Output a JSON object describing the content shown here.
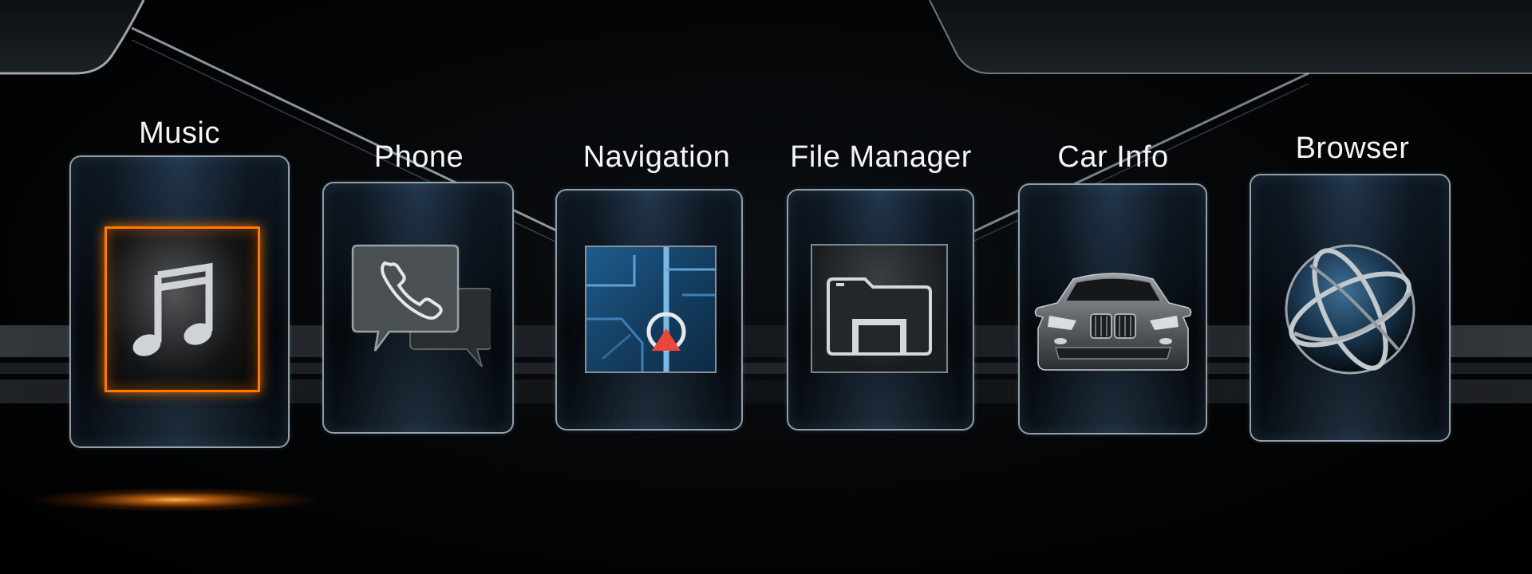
{
  "menu": {
    "items": [
      {
        "id": "music",
        "label": "Music",
        "icon": "music-note-icon",
        "selected": true
      },
      {
        "id": "phone",
        "label": "Phone",
        "icon": "phone-chat-icon",
        "selected": false
      },
      {
        "id": "navigation",
        "label": "Navigation",
        "icon": "map-navigation-icon",
        "selected": false
      },
      {
        "id": "file-manager",
        "label": "File Manager",
        "icon": "folder-icon",
        "selected": false
      },
      {
        "id": "car-info",
        "label": "Car Info",
        "icon": "car-icon",
        "selected": false
      },
      {
        "id": "browser",
        "label": "Browser",
        "icon": "globe-icon",
        "selected": false
      }
    ]
  },
  "colors": {
    "focus_accent": "#ff7a00",
    "label_text": "#f3f5f7",
    "tile_border": "#bfcdd7",
    "nav_arrow": "#e8473a",
    "nav_blue": "#1d5c8e"
  }
}
